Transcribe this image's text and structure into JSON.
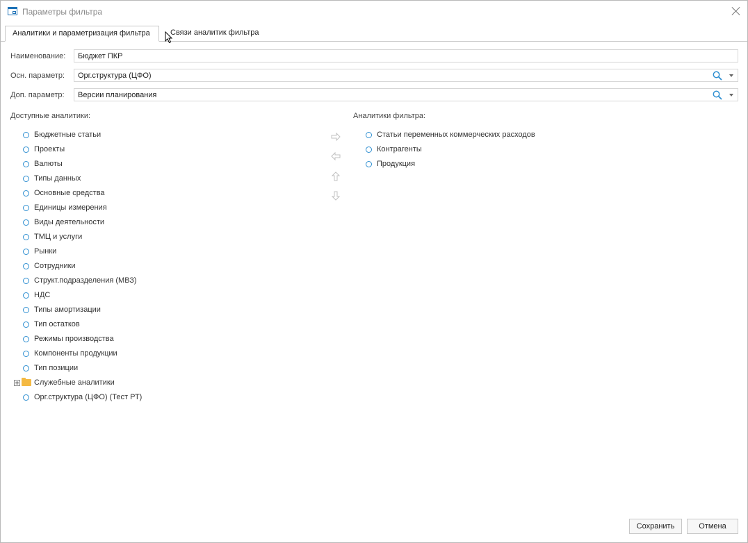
{
  "window": {
    "title": "Параметры фильтра"
  },
  "tabs": [
    {
      "label": "Аналитики и параметризация фильтра",
      "active": true
    },
    {
      "label": "Связи аналитик фильтра",
      "active": false
    }
  ],
  "fields": {
    "name_label": "Наименование:",
    "name_value": "Бюджет ПКР",
    "main_param_label": "Осн. параметр:",
    "main_param_value": "Орг.структура (ЦФО)",
    "extra_param_label": "Доп. параметр:",
    "extra_param_value": "Версии планирования"
  },
  "available": {
    "label": "Доступные аналитики:",
    "items": [
      "Бюджетные статьи",
      "Проекты",
      "Валюты",
      "Типы данных",
      "Основные средства",
      "Единицы измерения",
      "Виды деятельности",
      "ТМЦ и услуги",
      "Рынки",
      "Сотрудники",
      "Структ.подразделения (МВЗ)",
      "НДС",
      "Типы амортизации",
      "Тип остатков",
      "Режимы производства",
      "Компоненты продукции",
      "Тип позиции"
    ],
    "folder": "Служебные аналитики",
    "last_item": "Орг.структура (ЦФО) (Тест РТ)"
  },
  "filter": {
    "label": "Аналитики фильтра:",
    "items": [
      "Статьи переменных коммерческих расходов",
      "Контрагенты",
      "Продукция"
    ]
  },
  "buttons": {
    "save": "Сохранить",
    "cancel": "Отмена"
  },
  "colors": {
    "accent": "#2f8fd1",
    "folder": "#f4b942",
    "arrow_disabled": "#c0c0c0"
  }
}
